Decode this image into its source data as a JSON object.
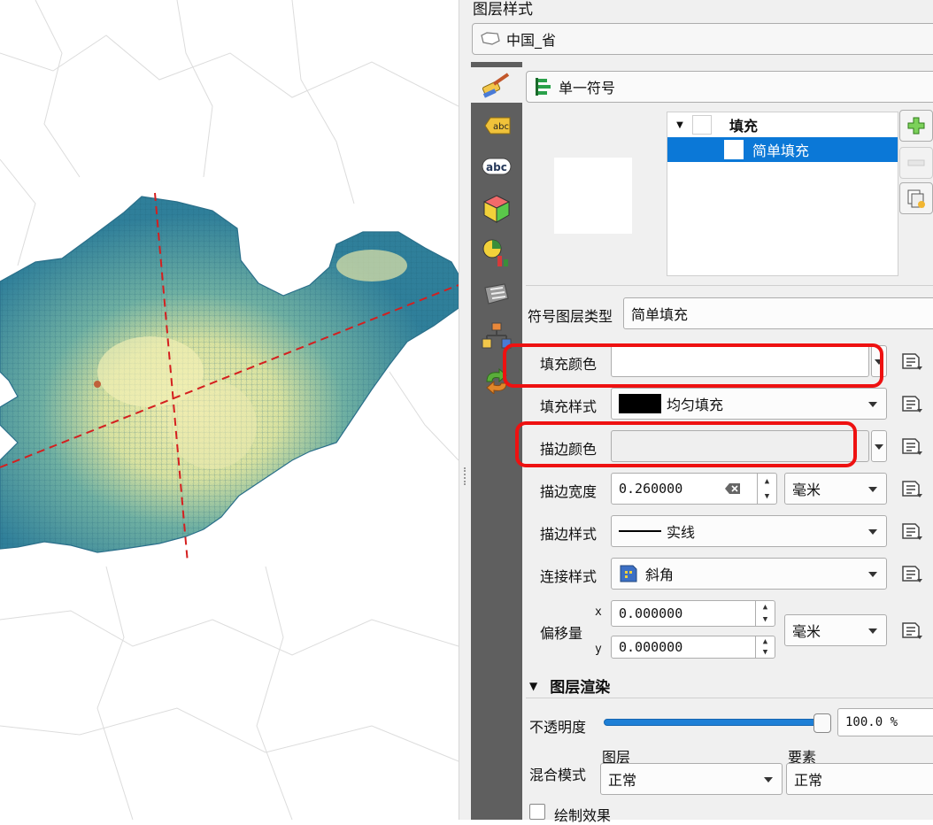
{
  "panel": {
    "title": "图层样式",
    "layer_name": "中国_省",
    "renderer": "单一符号"
  },
  "symbol_tree": {
    "root": "填充",
    "child": "简单填充"
  },
  "symbol_layer": {
    "type_label": "符号图层类型",
    "type_value": "简单填充",
    "fill_color_label": "填充颜色",
    "fill_style_label": "填充样式",
    "fill_style_value": "均匀填充",
    "stroke_color_label": "描边颜色",
    "stroke_width_label": "描边宽度",
    "stroke_width_value": "0.260000",
    "stroke_width_unit": "毫米",
    "stroke_style_label": "描边样式",
    "stroke_style_value": "实线",
    "join_style_label": "连接样式",
    "join_style_value": "斜角",
    "offset_label": "偏移量",
    "offset_x_label": "x",
    "offset_x_value": "0.000000",
    "offset_y_label": "y",
    "offset_y_value": "0.000000",
    "offset_unit": "毫米"
  },
  "rendering": {
    "section_title": "图层渲染",
    "opacity_label": "不透明度",
    "opacity_value": "100.0 %",
    "opacity_fraction": 1.0,
    "blend_label": "混合模式",
    "blend_layer_header": "图层",
    "blend_layer_value": "正常",
    "blend_feature_header": "要素",
    "blend_feature_value": "正常",
    "draw_effects_label": "绘制效果"
  },
  "colors": {
    "accent_selection": "#0b78d7",
    "annotation": "#ee1111",
    "fill_style_swatch": "#000000",
    "tab_bar": "#5f5f5f"
  },
  "icons": [
    "polygon-layer-icon",
    "paintbrush-icon",
    "label-abc-icon",
    "mask-abc-icon",
    "3d-cube-icon",
    "diagram-icon",
    "fields-icon",
    "actions-icon",
    "add-symbol-layer-icon",
    "remove-symbol-layer-icon",
    "duplicate-symbol-layer-icon",
    "clear-text-icon",
    "data-defined-override-icon"
  ]
}
